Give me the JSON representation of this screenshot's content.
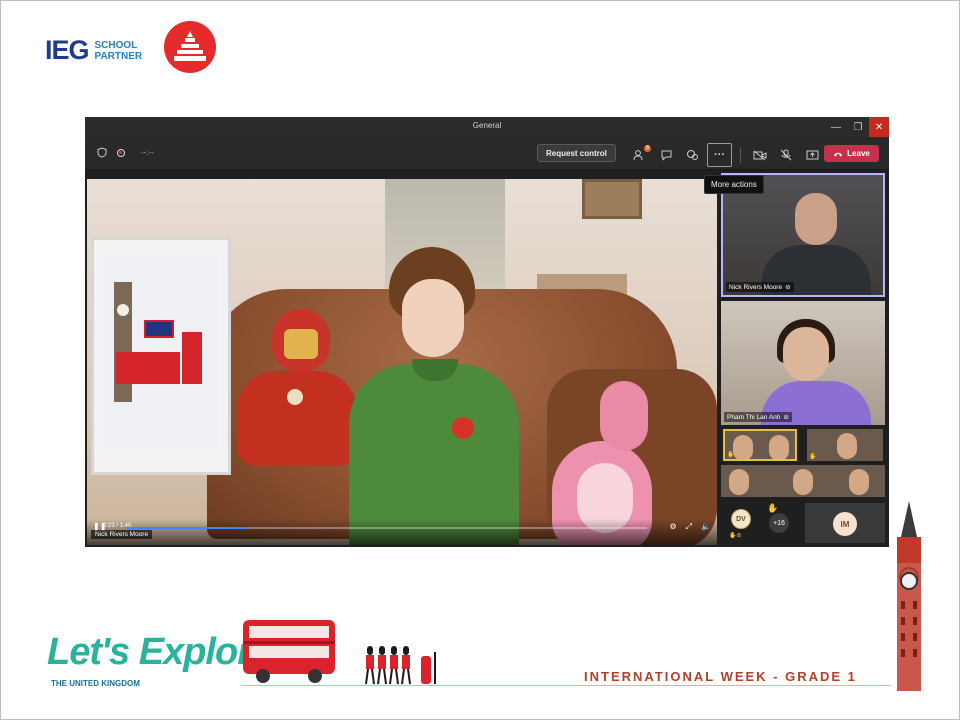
{
  "logos": {
    "ieg": "IEG",
    "ieg_sub_line1": "SCHOOL",
    "ieg_sub_line2": "PARTNER"
  },
  "window": {
    "title": "General",
    "minimize_icon": "minimize-icon",
    "restore_icon": "restore-icon",
    "close_icon": "close-icon"
  },
  "toolbar": {
    "timer": "--:--",
    "request_control_label": "Request control",
    "people_badge": "8",
    "leave_label": "Leave",
    "more_actions_tooltip": "More actions",
    "icons": [
      "shield-icon",
      "record-icon",
      "people-icon",
      "chat-icon",
      "reactions-icon",
      "more-icon",
      "camera-off-icon",
      "mic-off-icon",
      "share-icon",
      "phone-icon"
    ]
  },
  "main_video": {
    "presenter_name": "Nick Rivers Moore",
    "time_display": "0:23 / 1:40",
    "progress": 0.23,
    "controls": [
      "play-icon",
      "settings-icon",
      "fullscreen-icon",
      "volume-icon"
    ]
  },
  "participants": {
    "tile1_name": "Nick Rivers Moore",
    "tile2_name": "Pham Thi Lan Anh",
    "dv_initials": "DV",
    "overflow_count": "+16",
    "im_initials": "IM"
  },
  "branding": {
    "lets_explore": "Let's Explore",
    "subtitle": "THE UNITED KINGDOM",
    "footer": "INTERNATIONAL WEEK - GRADE 1"
  },
  "colors": {
    "leave": "#c4314b",
    "teal": "#2bb29c",
    "footer_red": "#b2402e",
    "ieg_blue": "#1c3d8f"
  }
}
